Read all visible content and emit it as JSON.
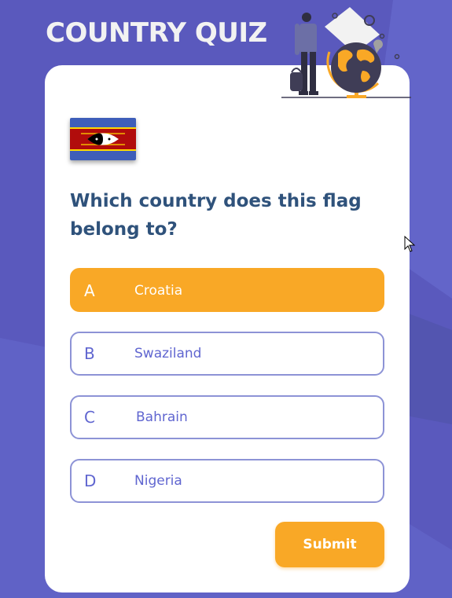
{
  "app": {
    "title": "COUNTRY QUIZ"
  },
  "quiz": {
    "question": "Which country does this flag belong to?",
    "flag_icon": "eswatini-flag-icon",
    "options": [
      {
        "letter": "A",
        "text": "Croatia",
        "selected": true
      },
      {
        "letter": "B",
        "text": "Swaziland",
        "selected": false
      },
      {
        "letter": "C",
        "text": "Bahrain",
        "selected": false
      },
      {
        "letter": "D",
        "text": "Nigeria",
        "selected": false
      }
    ],
    "submit_label": "Submit"
  },
  "colors": {
    "background": "#5a59bd",
    "accent": "#f9a826",
    "question_text": "#2f527b",
    "option_text": "#6066d0",
    "option_border": "#8d93d6"
  }
}
